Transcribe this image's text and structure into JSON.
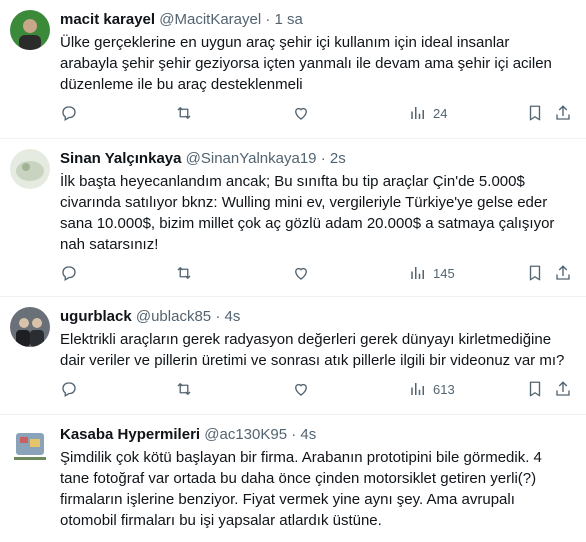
{
  "tweets": [
    {
      "name": "macit karayel",
      "handle": "@MacitKarayel",
      "time": "1 sa",
      "body": "Ülke gerçeklerine en uygun araç şehir içi kullanım için ideal insanlar arabayla şehir şehir geziyorsa içten yanmalı ile devam ama şehir içi acilen düzenleme ile bu araç desteklenmeli",
      "views": "24",
      "avatar_color": "#3a8a3a"
    },
    {
      "name": "Sinan Yalçınkaya",
      "handle": "@SinanYalnkaya19",
      "time": "2s",
      "body": "İlk başta heyecanlandım ancak; Bu sınıfta bu tip araçlar Çin'de 5.000$ civarında satılıyor bknz: Wulling mini ev, vergileriyle Türkiye'ye gelse eder sana 10.000$, bizim millet çok aç gözlü adam 20.000$ a satmaya çalışıyor nah satarsınız!",
      "views": "145",
      "avatar_color": "#cfd8c9"
    },
    {
      "name": "ugurblack",
      "handle": "@ublack85",
      "time": "4s",
      "body": "Elektrikli araçların gerek radyasyon değerleri gerek dünyayı kirletmediğine dair veriler ve pillerin üretimi ve sonrası atık pillerle ilgili bir videonuz var mı?",
      "views": "613",
      "avatar_color": "#4a4f55"
    },
    {
      "name": "Kasaba Hypermileri",
      "handle": "@ac130K95",
      "time": "4s",
      "body": "Şimdilik çok kötü başlayan bir firma. Arabanın prototipini bile görmedik. 4 tane fotoğraf var ortada bu daha önce çinden motorsiklet getiren yerli(?) firmaların işlerine benziyor. Fiyat vermek yine aynı şey. Ama avrupalı otomobil firmaları bu işi yapsalar atlardık üstüne.",
      "views": "",
      "avatar_color": "#8aa3b8"
    }
  ],
  "icons": {
    "reply": "reply-icon",
    "repost": "repost-icon",
    "like": "like-icon",
    "views": "views-icon",
    "bookmark": "bookmark-icon",
    "share": "share-icon"
  },
  "colors": {
    "text": "#0f1419",
    "muted": "#536471",
    "divider": "#eff3f4"
  }
}
